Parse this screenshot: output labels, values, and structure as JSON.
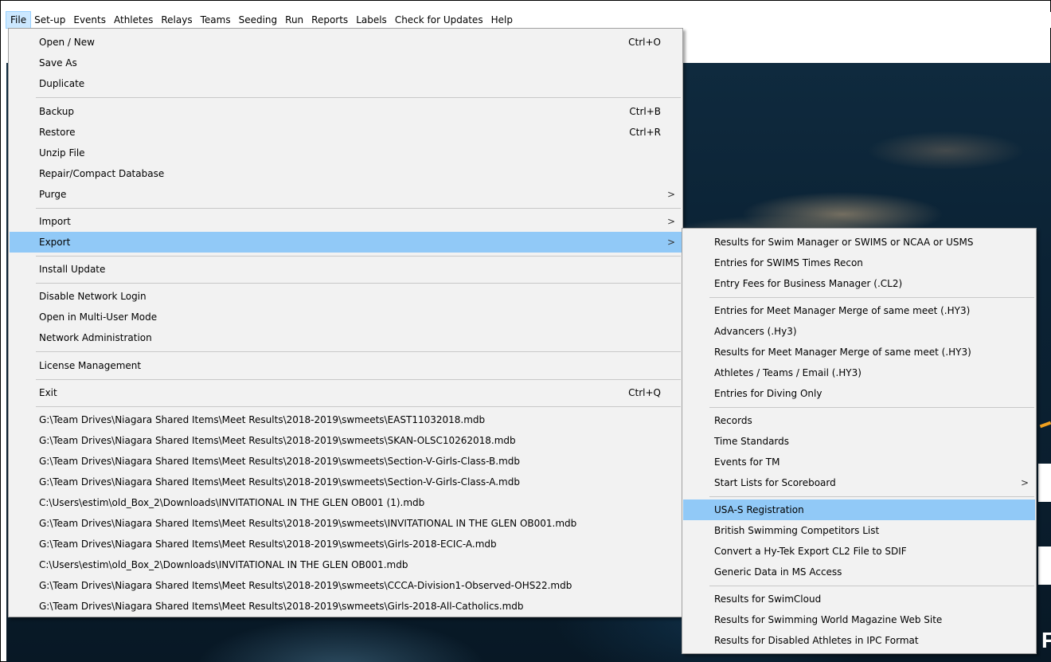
{
  "menubar": {
    "items": [
      "File",
      "Set-up",
      "Events",
      "Athletes",
      "Relays",
      "Teams",
      "Seeding",
      "Run",
      "Reports",
      "Labels",
      "Check for Updates",
      "Help"
    ]
  },
  "file_menu": {
    "items": [
      {
        "label": "Open / New",
        "shortcut": "Ctrl+O"
      },
      {
        "label": "Save As"
      },
      {
        "label": "Duplicate"
      },
      {
        "label": "Backup",
        "shortcut": "Ctrl+B"
      },
      {
        "label": "Restore",
        "shortcut": "Ctrl+R"
      },
      {
        "label": "Unzip File"
      },
      {
        "label": "Repair/Compact Database"
      },
      {
        "label": "Purge"
      },
      {
        "label": "Import"
      },
      {
        "label": "Export"
      },
      {
        "label": "Install Update"
      },
      {
        "label": "Disable Network Login"
      },
      {
        "label": "Open in Multi-User Mode"
      },
      {
        "label": "Network Administration"
      },
      {
        "label": "License Management"
      },
      {
        "label": "Exit",
        "shortcut": "Ctrl+Q"
      }
    ],
    "recent_files": [
      "G:\\Team Drives\\Niagara Shared Items\\Meet Results\\2018-2019\\swmeets\\EAST11032018.mdb",
      "G:\\Team Drives\\Niagara Shared Items\\Meet Results\\2018-2019\\swmeets\\SKAN-OLSC10262018.mdb",
      "G:\\Team Drives\\Niagara Shared Items\\Meet Results\\2018-2019\\swmeets\\Section-V-Girls-Class-B.mdb",
      "G:\\Team Drives\\Niagara Shared Items\\Meet Results\\2018-2019\\swmeets\\Section-V-Girls-Class-A.mdb",
      "C:\\Users\\estim\\old_Box_2\\Downloads\\INVITATIONAL IN THE GLEN OB001 (1).mdb",
      "G:\\Team Drives\\Niagara Shared Items\\Meet Results\\2018-2019\\swmeets\\INVITATIONAL IN THE GLEN OB001.mdb",
      "G:\\Team Drives\\Niagara Shared Items\\Meet Results\\2018-2019\\swmeets\\Girls-2018-ECIC-A.mdb",
      "C:\\Users\\estim\\old_Box_2\\Downloads\\INVITATIONAL IN THE GLEN OB001.mdb",
      "G:\\Team Drives\\Niagara Shared Items\\Meet Results\\2018-2019\\swmeets\\CCCA-Division1-Observed-OHS22.mdb",
      "G:\\Team Drives\\Niagara Shared Items\\Meet Results\\2018-2019\\swmeets\\Girls-2018-All-Catholics.mdb"
    ],
    "arrow": ">"
  },
  "export_menu": {
    "items": [
      "Results for Swim Manager or SWIMS or NCAA or USMS",
      "Entries for SWIMS Times Recon",
      "Entry Fees for Business Manager   (.CL2)",
      "Entries for Meet Manager Merge of same meet   (.HY3)",
      "Advancers   (.Hy3)",
      "Results for Meet Manager Merge of same meet   (.HY3)",
      "Athletes / Teams / Email  (.HY3)",
      "Entries for Diving Only",
      "Records",
      "Time Standards",
      "Events for TM",
      "Start Lists for Scoreboard",
      "USA-S Registration",
      "British Swimming Competitors List",
      "Convert a Hy-Tek Export CL2 File to SDIF",
      "Generic Data in MS Access",
      "Results for SwimCloud",
      "Results for Swimming World Magazine Web Site",
      "Results for Disabled Athletes in IPC Format"
    ]
  },
  "background": {
    "letter": "F"
  },
  "colors": {
    "highlight": "#91c9f7",
    "menu_bg": "#f2f2f2",
    "menubar_active": "#cce8ff"
  }
}
